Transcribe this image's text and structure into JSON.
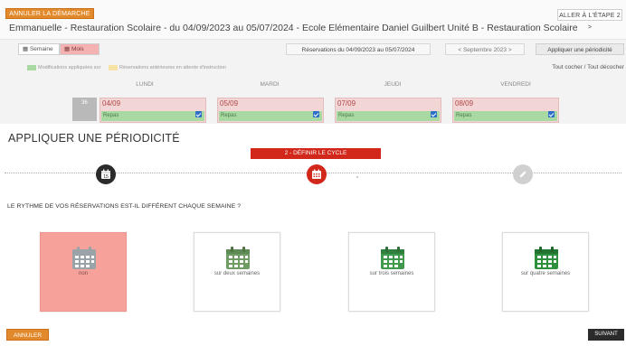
{
  "header": {
    "back_button": "Annuler la démarche",
    "next_step_button": "Aller à l'étape 2 >",
    "title": "Emmanuelle - Restauration Scolaire - du 04/09/2023 au 05/07/2024 - Ecole Elémentaire Daniel Guilbert Unité B - Restauration Scolaire"
  },
  "toolbar": {
    "view_week": "Semaine",
    "view_month": "Mois",
    "reservation_range": "Réservations du 04/09/2023 au 05/07/2024",
    "month_nav": "< Septembre 2023 >",
    "apply_periodicity": "Appliquer une périodicité"
  },
  "legend": {
    "green": "Modifications appliquées sur",
    "yellow": "Réservations antérieures en attente d'instruction",
    "check_all": "Tout cocher / Tout décocher"
  },
  "calendar": {
    "days": [
      "LUNDI",
      "MARDI",
      "JEUDI",
      "VENDREDI"
    ],
    "row_marker": "36",
    "cells": [
      {
        "date": "04/09",
        "meal": "Repas"
      },
      {
        "date": "05/09",
        "meal": "Repas"
      },
      {
        "date": "07/09",
        "meal": "Repas"
      },
      {
        "date": "08/09",
        "meal": "Repas"
      }
    ]
  },
  "modal": {
    "title": "APPLIQUER UNE PÉRIODICITÉ",
    "step_banner": "2 - DÉFINIR LE CYCLE",
    "question": "Le rythme de vos réservations est-il différent chaque semaine ?",
    "options": [
      {
        "label": "non",
        "color": "#9aa3a8"
      },
      {
        "label": "sur deux semaines",
        "color": "#6f9c63"
      },
      {
        "label": "sur trois semaines",
        "color": "#3f9a4e"
      },
      {
        "label": "sur quatre semaines",
        "color": "#2e8f3c"
      }
    ],
    "cancel_button": "Annuler",
    "next_button": "Suivant"
  },
  "colors": {
    "accent_red": "#d2281c",
    "accent_orange": "#e28a2b",
    "selected_option": "#f6a29b",
    "dark": "#2b2b2b"
  }
}
